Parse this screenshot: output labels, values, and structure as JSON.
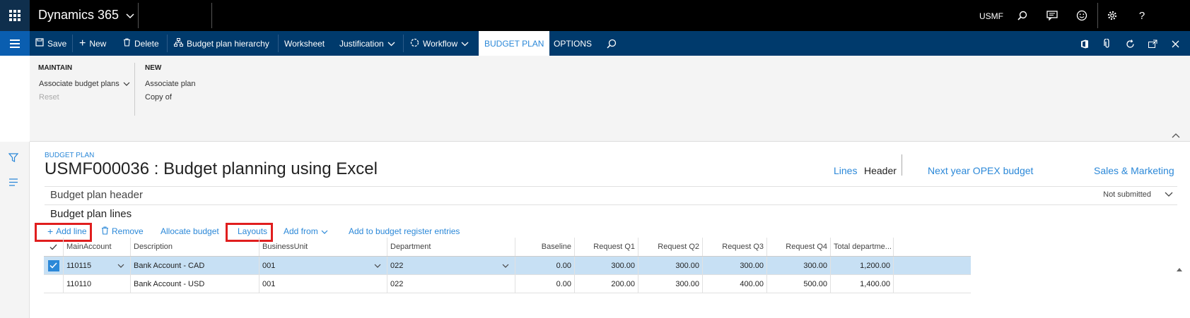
{
  "top": {
    "app_name": "Dynamics 365",
    "company": "USMF"
  },
  "actions": {
    "save": "Save",
    "new": "New",
    "delete": "Delete",
    "hierarchy": "Budget plan hierarchy",
    "worksheet": "Worksheet",
    "justification": "Justification",
    "workflow": "Workflow",
    "tab_budget_plan": "BUDGET PLAN",
    "tab_options": "OPTIONS"
  },
  "ribbon": {
    "maintain_title": "MAINTAIN",
    "associate_budget_plans": "Associate budget plans",
    "reset": "Reset",
    "new_title": "NEW",
    "associate_plan": "Associate plan",
    "copy_of": "Copy of"
  },
  "page": {
    "crumb": "BUDGET PLAN",
    "title": "USMF000036 : Budget planning using Excel",
    "view_lines": "Lines",
    "view_header": "Header",
    "scenario": "Next year OPEX budget",
    "department": "Sales & Marketing",
    "header_section": "Budget plan header",
    "status": "Not submitted",
    "lines_section": "Budget plan lines"
  },
  "toolbar": {
    "add_line": "Add line",
    "remove": "Remove",
    "allocate": "Allocate budget",
    "layouts": "Layouts",
    "add_from": "Add from",
    "add_register": "Add to budget register entries"
  },
  "grid": {
    "headers": {
      "main_account": "MainAccount",
      "description": "Description",
      "business_unit": "BusinessUnit",
      "department": "Department",
      "baseline": "Baseline",
      "q1": "Request Q1",
      "q2": "Request Q2",
      "q3": "Request Q3",
      "q4": "Request Q4",
      "total": "Total departme..."
    },
    "rows": [
      {
        "main_account": "110115",
        "description": "Bank Account - CAD",
        "business_unit": "001",
        "department": "022",
        "baseline": "0.00",
        "q1": "300.00",
        "q2": "300.00",
        "q3": "300.00",
        "q4": "300.00",
        "total": "1,200.00"
      },
      {
        "main_account": "110110",
        "description": "Bank Account - USD",
        "business_unit": "001",
        "department": "022",
        "baseline": "0.00",
        "q1": "200.00",
        "q2": "300.00",
        "q3": "400.00",
        "q4": "500.00",
        "total": "1,400.00"
      }
    ]
  },
  "colors": {
    "accent": "#2b88d8",
    "nav": "#003a6c",
    "highlight": "#e01e1e",
    "selected_row": "#c7e0f4"
  }
}
